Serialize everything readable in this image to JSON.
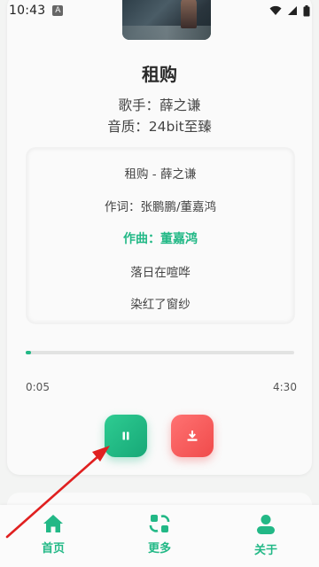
{
  "status_bar": {
    "time": "10:43",
    "notification_letter": "A"
  },
  "player": {
    "title": "租购",
    "singer_line": "歌手：薛之谦",
    "quality_line": "音质：24bit至臻",
    "lyrics": [
      {
        "text": "租购 - 薛之谦",
        "active": false
      },
      {
        "text": "作词：张鹏鹏/董嘉鸿",
        "active": false
      },
      {
        "text": "作曲：董嘉鸿",
        "active": true
      },
      {
        "text": "落日在喧哗",
        "active": false
      },
      {
        "text": "染红了窗纱",
        "active": false
      }
    ],
    "progress_fraction": 0.02,
    "current_time": "0:05",
    "total_time": "4:30",
    "pause_icon": "pause-icon",
    "download_icon": "download-icon"
  },
  "bottom_nav": {
    "items": [
      {
        "label": "首页",
        "icon": "home-icon"
      },
      {
        "label": "更多",
        "icon": "more-icon"
      },
      {
        "label": "关于",
        "icon": "user-icon"
      }
    ]
  },
  "colors": {
    "accent_green": "#22b886",
    "download_red": "#f04b4b",
    "annotation_arrow": "#e02020"
  }
}
